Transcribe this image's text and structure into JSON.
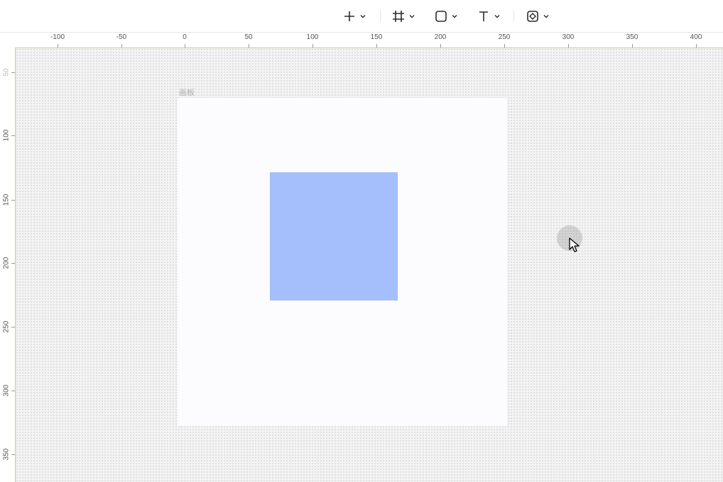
{
  "toolbar": {
    "tools": [
      {
        "name": "plus-icon",
        "label": "Add"
      },
      {
        "name": "frame-icon",
        "label": "Frame"
      },
      {
        "name": "rectangle-icon",
        "label": "Shape"
      },
      {
        "name": "text-icon",
        "label": "Text"
      },
      {
        "name": "component-icon",
        "label": "Component"
      }
    ]
  },
  "rulers": {
    "horizontal": [
      "-100",
      "-50",
      "0",
      "50",
      "100",
      "150",
      "200",
      "250",
      "300",
      "350",
      "400"
    ],
    "vertical": [
      "50",
      "100",
      "150",
      "200",
      "250",
      "300",
      "350"
    ]
  },
  "artboard": {
    "label": "画板",
    "background": "#fcfcfe"
  },
  "shape": {
    "fill": "#a5bffc"
  },
  "colors": {
    "canvas_bg": "#f4f4f4",
    "ruler_border": "#c8c8a4"
  }
}
